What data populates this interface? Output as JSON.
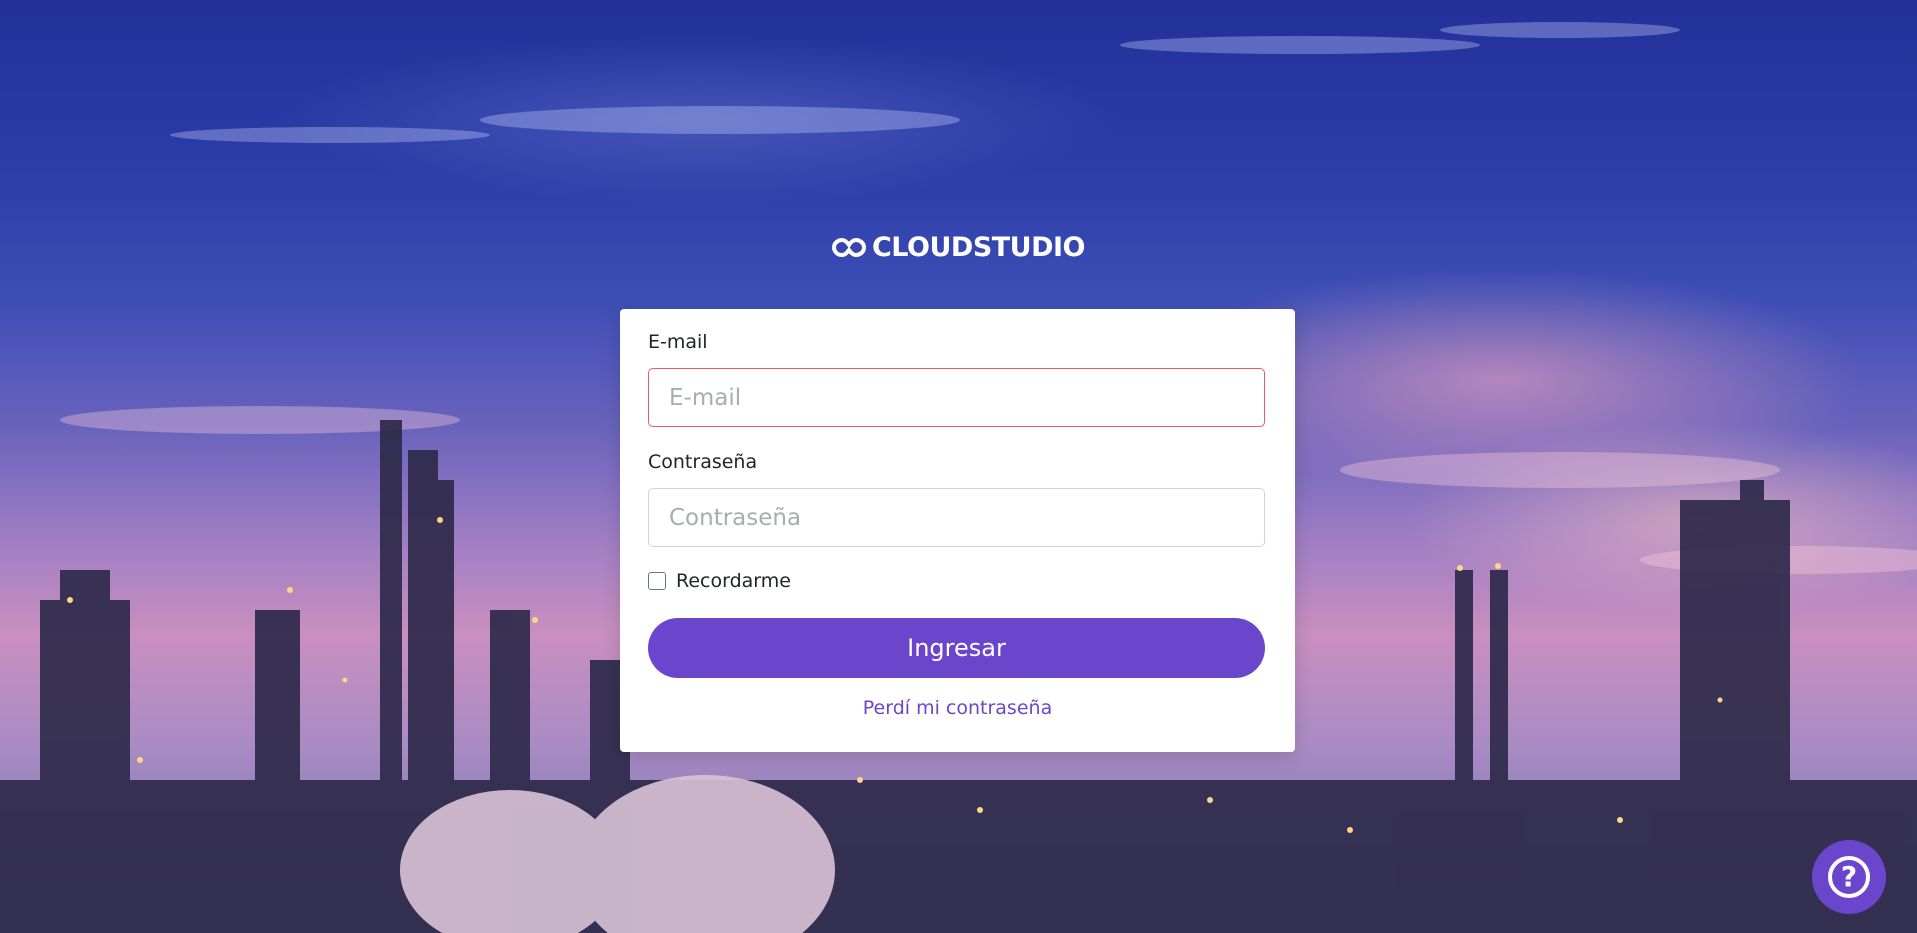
{
  "brand": {
    "logo_text": "CLOUDSTUDIO",
    "accent_color": "#6b46cc"
  },
  "login_form": {
    "email_label": "E-mail",
    "email_placeholder": "E-mail",
    "email_value": "",
    "password_label": "Contraseña",
    "password_placeholder": "Contraseña",
    "password_value": "",
    "remember_label": "Recordarme",
    "remember_checked": false,
    "submit_label": "Ingresar",
    "forgot_password_label": "Perdí mi contraseña"
  },
  "help": {
    "icon": "question-circle-icon"
  }
}
